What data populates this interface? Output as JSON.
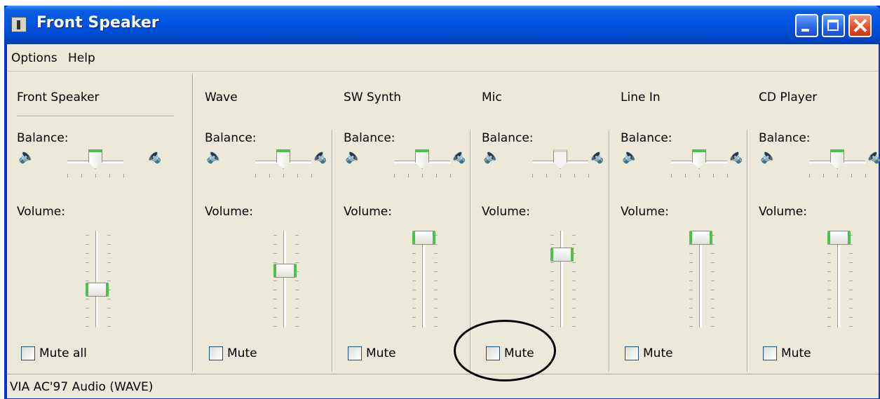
{
  "window": {
    "title": "Front Speaker",
    "buttons": [
      "minimize",
      "maximize",
      "close"
    ],
    "accent_color": "#0054e3"
  },
  "menu": {
    "items": [
      "Options",
      "Help"
    ]
  },
  "master": {
    "title": "Front Speaker",
    "balance_label": "Balance:",
    "volume_label": "Volume:",
    "mute_label": "Mute all",
    "muted": false,
    "balance": 0.5,
    "volume": 0.37
  },
  "channels": [
    {
      "title": "Wave",
      "balance_label": "Balance:",
      "volume_label": "Volume:",
      "mute_label": "Mute",
      "muted": false,
      "balance": 0.5,
      "volume": 0.6,
      "enabled": true
    },
    {
      "title": "SW Synth",
      "balance_label": "Balance:",
      "volume_label": "Volume:",
      "mute_label": "Mute",
      "muted": false,
      "balance": 0.5,
      "volume": 1.0,
      "enabled": true
    },
    {
      "title": "Mic",
      "balance_label": "Balance:",
      "volume_label": "Volume:",
      "mute_label": "Mute",
      "muted": false,
      "balance": 0.5,
      "volume": 0.8,
      "enabled": false,
      "highlighted": true
    },
    {
      "title": "Line In",
      "balance_label": "Balance:",
      "volume_label": "Volume:",
      "mute_label": "Mute",
      "muted": false,
      "balance": 0.5,
      "volume": 1.0,
      "enabled": true
    },
    {
      "title": "CD Player",
      "balance_label": "Balance:",
      "volume_label": "Volume:",
      "mute_label": "Mute",
      "muted": false,
      "balance": 0.5,
      "volume": 1.0,
      "enabled": true
    }
  ],
  "status": {
    "device": "VIA AC'97 Audio (WAVE)"
  },
  "icons": {
    "title": "mixer-app-icon",
    "balance_left": "speaker-left-icon",
    "balance_right": "speaker-right-icon"
  }
}
